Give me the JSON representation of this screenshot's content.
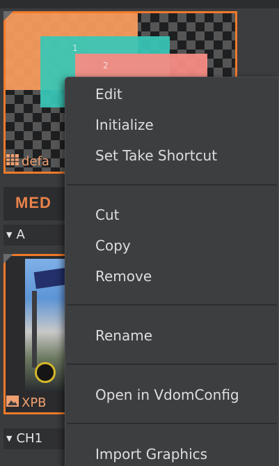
{
  "tiles": [
    {
      "label": "defa",
      "icon": "grid-icon"
    },
    {
      "label": "XPB",
      "icon": "image-icon"
    }
  ],
  "section": {
    "title": "MED"
  },
  "groups": [
    {
      "label": "A"
    },
    {
      "label": "CH1"
    }
  ],
  "layers": [
    "1",
    "2"
  ],
  "context_menu": {
    "items": [
      "Edit",
      "Initialize",
      "Set Take Shortcut",
      "Cut",
      "Copy",
      "Remove",
      "Rename",
      "Open in VdomConfig",
      "Import Graphics"
    ]
  },
  "colors": {
    "accent": "#f07a2a",
    "menu_bg": "#3d3e40",
    "menu_text": "#dedede"
  }
}
